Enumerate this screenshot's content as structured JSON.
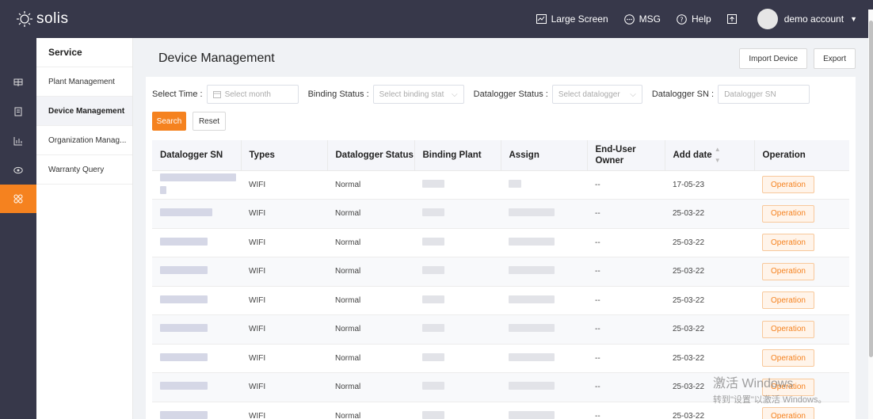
{
  "brand": {
    "name": "solis"
  },
  "topbar": {
    "large_screen": "Large Screen",
    "msg": "MSG",
    "help": "Help",
    "user": "demo account"
  },
  "rail": [
    "plant-icon",
    "device-icon",
    "chart-icon",
    "eye-icon",
    "apps-icon"
  ],
  "submenu": {
    "title": "Service",
    "items": [
      {
        "label": "Plant Management"
      },
      {
        "label": "Device Management"
      },
      {
        "label": "Organization Manag..."
      },
      {
        "label": "Warranty Query"
      }
    ]
  },
  "page": {
    "title": "Device Management",
    "import_btn": "Import Device",
    "export_btn": "Export"
  },
  "filters": {
    "time_label": "Select Time :",
    "time_placeholder": "Select month",
    "binding_label": "Binding Status :",
    "binding_placeholder": "Select binding stat",
    "dl_status_label": "Datalogger Status :",
    "dl_status_placeholder": "Select datalogger",
    "dl_sn_label": "Datalogger SN :",
    "dl_sn_placeholder": "Datalogger SN",
    "search": "Search",
    "reset": "Reset"
  },
  "table": {
    "headers": [
      "Datalogger SN",
      "Types",
      "Datalogger Status",
      "Binding Plant",
      "Assign",
      "End-User Owner",
      "Add date",
      "Operation"
    ],
    "rows": [
      {
        "type": "WIFI",
        "status": "Normal",
        "owner": "--",
        "date": "17-05-23",
        "op": "Operation"
      },
      {
        "type": "WIFI",
        "status": "Normal",
        "owner": "--",
        "date": "25-03-22",
        "op": "Operation"
      },
      {
        "type": "WIFI",
        "status": "Normal",
        "owner": "--",
        "date": "25-03-22",
        "op": "Operation"
      },
      {
        "type": "WIFI",
        "status": "Normal",
        "owner": "--",
        "date": "25-03-22",
        "op": "Operation"
      },
      {
        "type": "WIFI",
        "status": "Normal",
        "owner": "--",
        "date": "25-03-22",
        "op": "Operation"
      },
      {
        "type": "WIFI",
        "status": "Normal",
        "owner": "--",
        "date": "25-03-22",
        "op": "Operation"
      },
      {
        "type": "WIFI",
        "status": "Normal",
        "owner": "--",
        "date": "25-03-22",
        "op": "Operation"
      },
      {
        "type": "WIFI",
        "status": "Normal",
        "owner": "--",
        "date": "25-03-22",
        "op": "Operation"
      },
      {
        "type": "WIFI",
        "status": "Normal",
        "owner": "--",
        "date": "25-03-22",
        "op": "Operation"
      }
    ]
  },
  "watermark": {
    "line1": "激活 Windows",
    "line2": "转到\"设置\"以激活 Windows。"
  },
  "colors": {
    "accent": "#f5821f",
    "nav_bg": "#37384a"
  }
}
